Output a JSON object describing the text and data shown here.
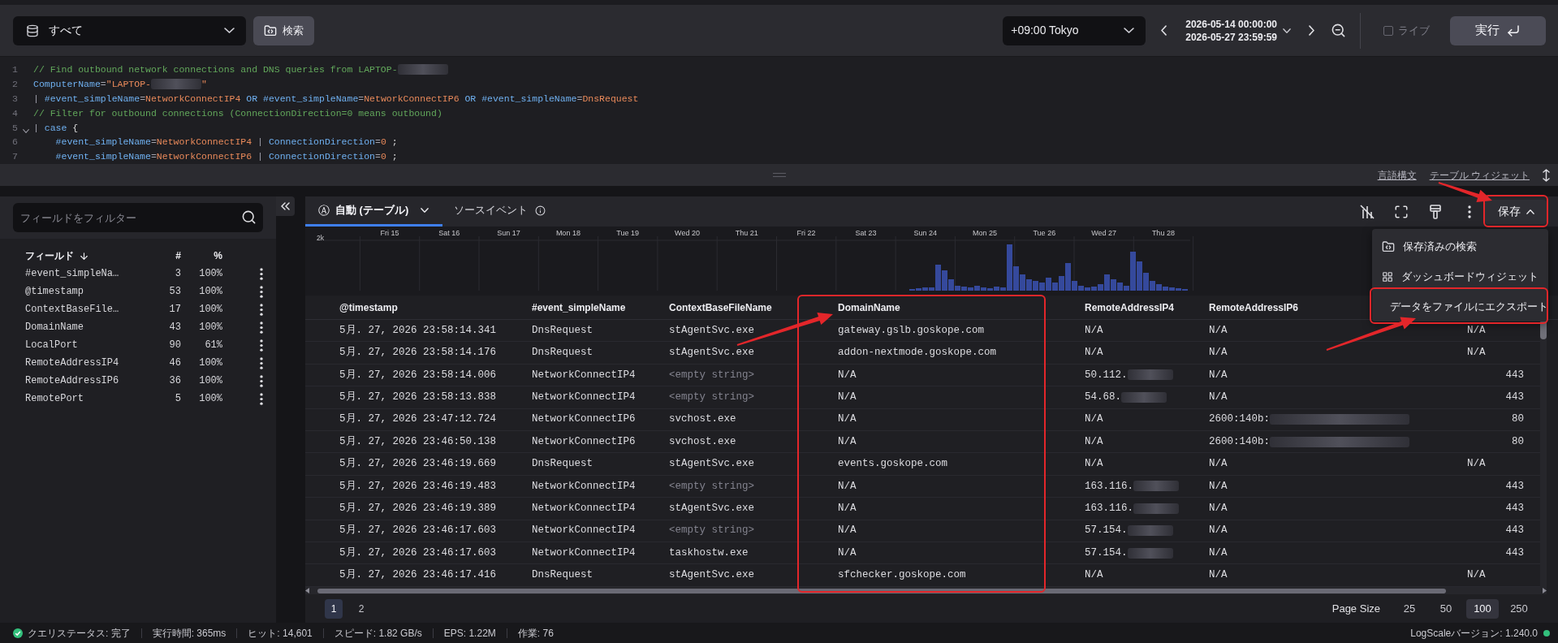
{
  "toolbar": {
    "datasource": "すべて",
    "search_button": "検索",
    "timezone": "+09:00 Tokyo",
    "range_start": "2026-05-14 00:00:00",
    "range_end": "2026-05-27 23:59:59",
    "live": {
      "label": "ライブ",
      "checked": false,
      "disabled": true
    },
    "run_button": "実行"
  },
  "editor": {
    "lines": [
      {
        "number": "1",
        "fold": false,
        "tokens": [
          {
            "kind": "comment",
            "text": "// Find outbound network connections and DNS queries from LAPTOP-"
          },
          {
            "kind": "redacted"
          }
        ]
      },
      {
        "number": "2",
        "fold": false,
        "tokens": [
          {
            "kind": "field",
            "text": "ComputerName"
          },
          {
            "kind": "op",
            "text": "="
          },
          {
            "kind": "value",
            "text": "\"LAPTOP-"
          },
          {
            "kind": "redacted"
          },
          {
            "kind": "value",
            "text": "\""
          }
        ]
      },
      {
        "number": "3",
        "fold": false,
        "tokens": [
          {
            "kind": "op",
            "text": "| "
          },
          {
            "kind": "field",
            "text": "#event_simpleName"
          },
          {
            "kind": "op",
            "text": "="
          },
          {
            "kind": "value",
            "text": "NetworkConnectIP4"
          },
          {
            "kind": "keyword",
            "text": " OR "
          },
          {
            "kind": "field",
            "text": "#event_simpleName"
          },
          {
            "kind": "op",
            "text": "="
          },
          {
            "kind": "value",
            "text": "NetworkConnectIP6"
          },
          {
            "kind": "keyword",
            "text": " OR "
          },
          {
            "kind": "field",
            "text": "#event_simpleName"
          },
          {
            "kind": "op",
            "text": "="
          },
          {
            "kind": "value",
            "text": "DnsRequest"
          }
        ]
      },
      {
        "number": "4",
        "fold": false,
        "tokens": [
          {
            "kind": "comment",
            "text": "// Filter for outbound connections (ConnectionDirection=0 means outbound)"
          }
        ]
      },
      {
        "number": "5",
        "fold": true,
        "tokens": [
          {
            "kind": "op",
            "text": "| "
          },
          {
            "kind": "keyword",
            "text": "case"
          },
          {
            "kind": "plain",
            "text": " {"
          }
        ]
      },
      {
        "number": "6",
        "fold": false,
        "tokens": [
          {
            "kind": "field",
            "text": "    #event_simpleName"
          },
          {
            "kind": "op",
            "text": "="
          },
          {
            "kind": "value",
            "text": "NetworkConnectIP4"
          },
          {
            "kind": "op",
            "text": " | "
          },
          {
            "kind": "field",
            "text": "ConnectionDirection"
          },
          {
            "kind": "op",
            "text": "="
          },
          {
            "kind": "value",
            "text": "0"
          },
          {
            "kind": "plain",
            "text": " ;"
          }
        ]
      },
      {
        "number": "7",
        "fold": false,
        "tokens": [
          {
            "kind": "field",
            "text": "    #event_simpleName"
          },
          {
            "kind": "op",
            "text": "="
          },
          {
            "kind": "value",
            "text": "NetworkConnectIP6"
          },
          {
            "kind": "op",
            "text": " | "
          },
          {
            "kind": "field",
            "text": "ConnectionDirection"
          },
          {
            "kind": "op",
            "text": "="
          },
          {
            "kind": "value",
            "text": "0"
          },
          {
            "kind": "plain",
            "text": " ;"
          }
        ]
      }
    ]
  },
  "editor_links": [
    "言語構文",
    "テーブル ウィジェット"
  ],
  "field_panel": {
    "filter_placeholder": "フィールドをフィルター",
    "columns": {
      "name": "フィールド",
      "count": "#",
      "percent": "%"
    },
    "fields": [
      {
        "name": "#event_simpleNa…",
        "count": "3",
        "percent": "100%"
      },
      {
        "name": "@timestamp",
        "count": "53",
        "percent": "100%"
      },
      {
        "name": "ContextBaseFile…",
        "count": "17",
        "percent": "100%"
      },
      {
        "name": "DomainName",
        "count": "43",
        "percent": "100%"
      },
      {
        "name": "LocalPort",
        "count": "90",
        "percent": "61%"
      },
      {
        "name": "RemoteAddressIP4",
        "count": "46",
        "percent": "100%"
      },
      {
        "name": "RemoteAddressIP6",
        "count": "36",
        "percent": "100%"
      },
      {
        "name": "RemotePort",
        "count": "5",
        "percent": "100%"
      }
    ]
  },
  "results": {
    "tabs": [
      {
        "kind": "view",
        "glyph": "Ⓐ",
        "label": "自動 (テーブル)",
        "selected": true
      },
      {
        "kind": "info",
        "label": "ソースイベント",
        "selected": false
      }
    ],
    "save": {
      "label": "保存",
      "expanded": true,
      "annotated": true,
      "menu": [
        {
          "kind": "saved-search",
          "label": "保存済みの検索",
          "annotated": false
        },
        {
          "kind": "dashboard-widget",
          "label": "ダッシュボードウィジェット",
          "annotated": false
        },
        {
          "kind": "export",
          "label": "データをファイルにエクスポート",
          "annotated": true
        }
      ]
    },
    "histogram": {
      "y_tick": "2k",
      "x_labels": [
        "Fri 15",
        "Sat 16",
        "Sun 17",
        "Mon 18",
        "Tue 19",
        "Wed 20",
        "Thu 21",
        "Fri 22",
        "Sat 23",
        "Sun 24",
        "Mon 25",
        "Tue 26",
        "Wed 27",
        "Thu 28"
      ]
    },
    "table": {
      "columns": [
        {
          "label": "@timestamp",
          "annotated": false
        },
        {
          "label": "#event_simpleName",
          "annotated": false
        },
        {
          "label": "ContextBaseFileName",
          "annotated": false
        },
        {
          "label": "DomainName",
          "annotated": true
        },
        {
          "label": "RemoteAddressIP4",
          "annotated": false
        },
        {
          "label": "RemoteAddressIP6",
          "annotated": false
        }
      ],
      "rows": [
        {
          "cells": [
            {
              "text": "5月. 27, 2026 23:58:14.341",
              "kind": "text"
            },
            {
              "text": "DnsRequest",
              "kind": "text"
            },
            {
              "text": "stAgentSvc.exe",
              "kind": "text"
            },
            {
              "text": "gateway.gslb.goskope.com",
              "kind": "text"
            },
            {
              "text": "N/A",
              "kind": "text"
            },
            {
              "text": "N/A",
              "kind": "text"
            },
            {
              "text": "N/A",
              "kind": "text"
            }
          ]
        },
        {
          "cells": [
            {
              "text": "5月. 27, 2026 23:58:14.176",
              "kind": "text"
            },
            {
              "text": "DnsRequest",
              "kind": "text"
            },
            {
              "text": "stAgentSvc.exe",
              "kind": "text"
            },
            {
              "text": "addon-nextmode.goskope.com",
              "kind": "text"
            },
            {
              "text": "N/A",
              "kind": "text"
            },
            {
              "text": "N/A",
              "kind": "text"
            },
            {
              "text": "N/A",
              "kind": "text"
            }
          ]
        },
        {
          "cells": [
            {
              "text": "5月. 27, 2026 23:58:14.006",
              "kind": "text"
            },
            {
              "text": "NetworkConnectIP4",
              "kind": "text"
            },
            {
              "text": "<empty string>",
              "kind": "empty"
            },
            {
              "text": "N/A",
              "kind": "text"
            },
            {
              "text": "50.112.",
              "kind": "redacted"
            },
            {
              "text": "N/A",
              "kind": "text"
            },
            {
              "text": "443",
              "kind": "number"
            }
          ]
        },
        {
          "cells": [
            {
              "text": "5月. 27, 2026 23:58:13.838",
              "kind": "text"
            },
            {
              "text": "NetworkConnectIP4",
              "kind": "text"
            },
            {
              "text": "<empty string>",
              "kind": "empty"
            },
            {
              "text": "N/A",
              "kind": "text"
            },
            {
              "text": "54.68.",
              "kind": "redacted"
            },
            {
              "text": "N/A",
              "kind": "text"
            },
            {
              "text": "443",
              "kind": "number"
            }
          ]
        },
        {
          "cells": [
            {
              "text": "5月. 27, 2026 23:47:12.724",
              "kind": "text"
            },
            {
              "text": "NetworkConnectIP6",
              "kind": "text"
            },
            {
              "text": "svchost.exe",
              "kind": "text"
            },
            {
              "text": "N/A",
              "kind": "text"
            },
            {
              "text": "N/A",
              "kind": "text"
            },
            {
              "text": "2600:140b:",
              "kind": "redacted"
            },
            {
              "text": "80",
              "kind": "number"
            }
          ]
        },
        {
          "cells": [
            {
              "text": "5月. 27, 2026 23:46:50.138",
              "kind": "text"
            },
            {
              "text": "NetworkConnectIP6",
              "kind": "text"
            },
            {
              "text": "svchost.exe",
              "kind": "text"
            },
            {
              "text": "N/A",
              "kind": "text"
            },
            {
              "text": "N/A",
              "kind": "text"
            },
            {
              "text": "2600:140b:",
              "kind": "redacted"
            },
            {
              "text": "80",
              "kind": "number"
            }
          ]
        },
        {
          "cells": [
            {
              "text": "5月. 27, 2026 23:46:19.669",
              "kind": "text"
            },
            {
              "text": "DnsRequest",
              "kind": "text"
            },
            {
              "text": "stAgentSvc.exe",
              "kind": "text"
            },
            {
              "text": "events.goskope.com",
              "kind": "text"
            },
            {
              "text": "N/A",
              "kind": "text"
            },
            {
              "text": "N/A",
              "kind": "text"
            },
            {
              "text": "N/A",
              "kind": "text"
            }
          ]
        },
        {
          "cells": [
            {
              "text": "5月. 27, 2026 23:46:19.483",
              "kind": "text"
            },
            {
              "text": "NetworkConnectIP4",
              "kind": "text"
            },
            {
              "text": "<empty string>",
              "kind": "empty"
            },
            {
              "text": "N/A",
              "kind": "text"
            },
            {
              "text": "163.116.",
              "kind": "redacted"
            },
            {
              "text": "N/A",
              "kind": "text"
            },
            {
              "text": "443",
              "kind": "number"
            }
          ]
        },
        {
          "cells": [
            {
              "text": "5月. 27, 2026 23:46:19.389",
              "kind": "text"
            },
            {
              "text": "NetworkConnectIP4",
              "kind": "text"
            },
            {
              "text": "stAgentSvc.exe",
              "kind": "text"
            },
            {
              "text": "N/A",
              "kind": "text"
            },
            {
              "text": "163.116.",
              "kind": "redacted"
            },
            {
              "text": "N/A",
              "kind": "text"
            },
            {
              "text": "443",
              "kind": "number"
            }
          ]
        },
        {
          "cells": [
            {
              "text": "5月. 27, 2026 23:46:17.603",
              "kind": "text"
            },
            {
              "text": "NetworkConnectIP4",
              "kind": "text"
            },
            {
              "text": "<empty string>",
              "kind": "empty"
            },
            {
              "text": "N/A",
              "kind": "text"
            },
            {
              "text": "57.154.",
              "kind": "redacted"
            },
            {
              "text": "N/A",
              "kind": "text"
            },
            {
              "text": "443",
              "kind": "number"
            }
          ]
        },
        {
          "cells": [
            {
              "text": "5月. 27, 2026 23:46:17.603",
              "kind": "text"
            },
            {
              "text": "NetworkConnectIP4",
              "kind": "text"
            },
            {
              "text": "taskhostw.exe",
              "kind": "text"
            },
            {
              "text": "N/A",
              "kind": "text"
            },
            {
              "text": "57.154.",
              "kind": "redacted"
            },
            {
              "text": "N/A",
              "kind": "text"
            },
            {
              "text": "443",
              "kind": "number"
            }
          ]
        },
        {
          "cells": [
            {
              "text": "5月. 27, 2026 23:46:17.416",
              "kind": "text"
            },
            {
              "text": "DnsRequest",
              "kind": "text"
            },
            {
              "text": "stAgentSvc.exe",
              "kind": "text"
            },
            {
              "text": "sfchecker.goskope.com",
              "kind": "text"
            },
            {
              "text": "N/A",
              "kind": "text"
            },
            {
              "text": "N/A",
              "kind": "text"
            },
            {
              "text": "N/A",
              "kind": "text"
            }
          ]
        }
      ]
    },
    "pagination": {
      "pages": [
        {
          "label": "1",
          "selected": true
        },
        {
          "label": "2",
          "selected": false
        }
      ],
      "page_size_label": "Page Size",
      "page_sizes": [
        {
          "label": "25",
          "selected": false
        },
        {
          "label": "50",
          "selected": false
        },
        {
          "label": "100",
          "selected": true
        },
        {
          "label": "250",
          "selected": false
        }
      ]
    }
  },
  "status_bar": {
    "items": [
      {
        "kind": "status",
        "label": "クエリステータス: 完了"
      },
      {
        "kind": "metric",
        "label": "実行時間: 365ms"
      },
      {
        "kind": "metric",
        "label": "ヒット: 14,601"
      },
      {
        "kind": "metric",
        "label": "スピード: 1.82 GB/s"
      },
      {
        "kind": "metric",
        "label": "EPS: 1.22M"
      },
      {
        "kind": "metric",
        "label": "作業: 76"
      }
    ],
    "version": "LogScaleバージョン: 1.240.0"
  }
}
